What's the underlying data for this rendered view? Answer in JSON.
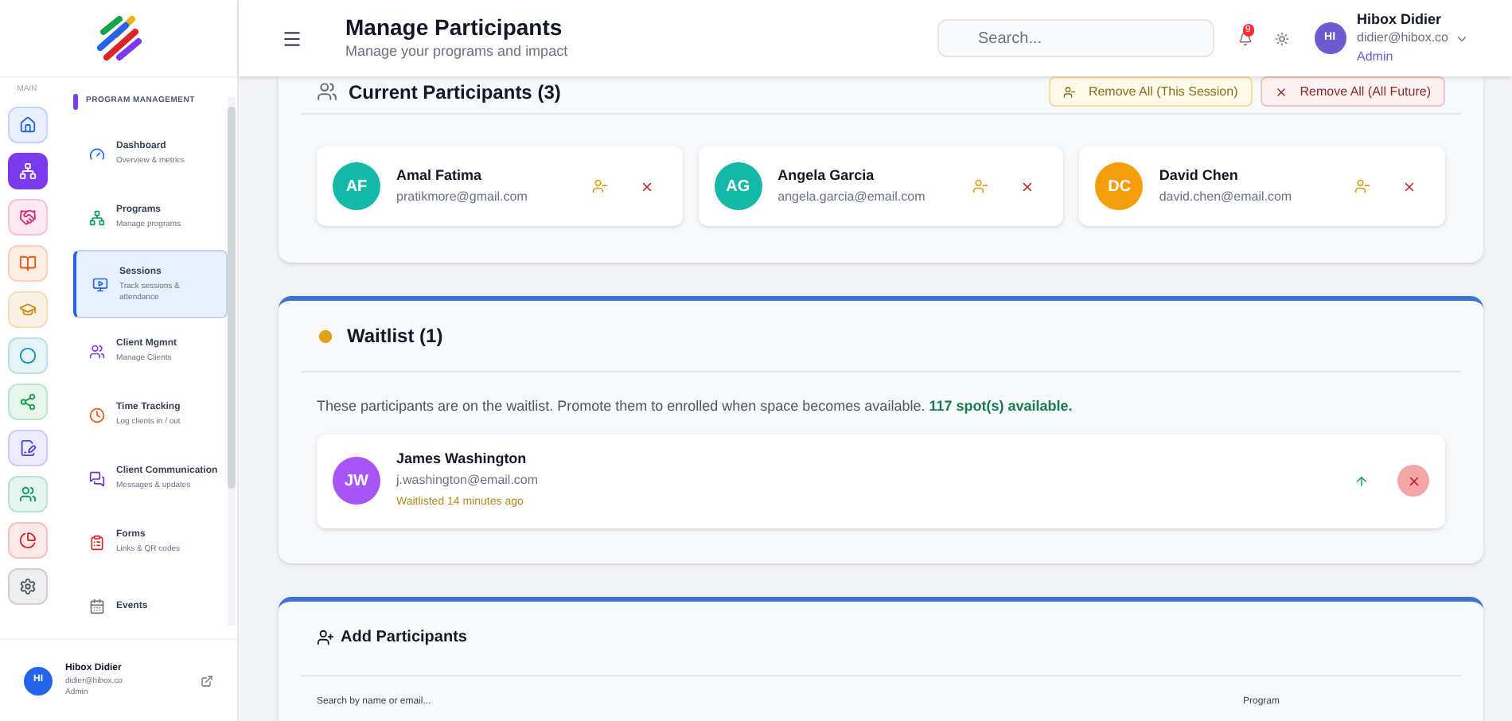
{
  "sidebar": {
    "rail_label": "MAIN",
    "rail": [
      {
        "color": "#2563eb",
        "selected": false
      },
      {
        "color": "#7c3aed",
        "selected": true
      },
      {
        "color": "#db2777",
        "selected": false
      },
      {
        "color": "#ea580c",
        "selected": false
      },
      {
        "color": "#ca8a04",
        "selected": false
      },
      {
        "color": "#0891b2",
        "selected": false
      },
      {
        "color": "#16a34a",
        "selected": false
      },
      {
        "color": "#4f46e5",
        "selected": false
      },
      {
        "color": "#059669",
        "selected": false
      },
      {
        "color": "#dc2626",
        "selected": false
      },
      {
        "color": "#4b5563",
        "selected": false
      }
    ],
    "section_title": "PROGRAM MANAGEMENT",
    "items": [
      {
        "title": "Dashboard",
        "subtitle": "Overview & metrics",
        "color": "#2563eb",
        "selected": false
      },
      {
        "title": "Programs",
        "subtitle": "Manage programs",
        "color": "#059669",
        "selected": false
      },
      {
        "title": "Sessions",
        "subtitle": "Track sessions & attendance",
        "color": "#2563eb",
        "selected": true
      },
      {
        "title": "Client Mgmnt",
        "subtitle": "Manage Clients",
        "color": "#7c3aed",
        "selected": false
      },
      {
        "title": "Time Tracking",
        "subtitle": "Log clients in / out",
        "color": "#ea580c",
        "selected": false
      },
      {
        "title": "Client Communication",
        "subtitle": "Messages & updates",
        "color": "#6d28d9",
        "selected": false
      },
      {
        "title": "Forms",
        "subtitle": "Links & QR codes",
        "color": "#dc2626",
        "selected": false
      },
      {
        "title": "Events",
        "color": "#6b7280",
        "selected": false
      }
    ],
    "user": {
      "initials": "HI",
      "name": "Hibox Didier",
      "email": "didier@hibox.co",
      "role": "Admin"
    }
  },
  "header": {
    "title": "Manage Participants",
    "subtitle": "Manage your programs and impact",
    "search": {
      "placeholder": "Search..."
    },
    "notification_count": "9",
    "user": {
      "initials": "HI",
      "name": "Hibox Didier",
      "email": "didier@hibox.co",
      "role": "Admin"
    }
  },
  "current": {
    "title": "Current Participants (3)",
    "actions": [
      {
        "label": "Remove All (This Session)",
        "kind": "warning"
      },
      {
        "label": "Remove All (All Future)",
        "kind": "danger"
      }
    ],
    "participants": [
      {
        "initials": "AF",
        "name": "Amal Fatima",
        "email": "pratikmore@gmail.com",
        "color": "#14b8a6"
      },
      {
        "initials": "AG",
        "name": "Angela Garcia",
        "email": "angela.garcia@email.com",
        "color": "#14b8a6"
      },
      {
        "initials": "DC",
        "name": "David Chen",
        "email": "david.chen@email.com",
        "color": "#f59e0b"
      }
    ]
  },
  "waitlist": {
    "title": "Waitlist (1)",
    "note": "These participants are on the waitlist. Promote them to enrolled when space becomes available.",
    "spots": "117 spot(s) available.",
    "entries": [
      {
        "initials": "JW",
        "name": "James Washington",
        "email": "j.washington@email.com",
        "since": "Waitlisted 14 minutes ago",
        "color": "#a855f7",
        "remove_hovered": true
      }
    ]
  },
  "add": {
    "title": "Add Participants",
    "fields": [
      {
        "label": "Search by name or email..."
      },
      {
        "label": "Program"
      }
    ]
  }
}
